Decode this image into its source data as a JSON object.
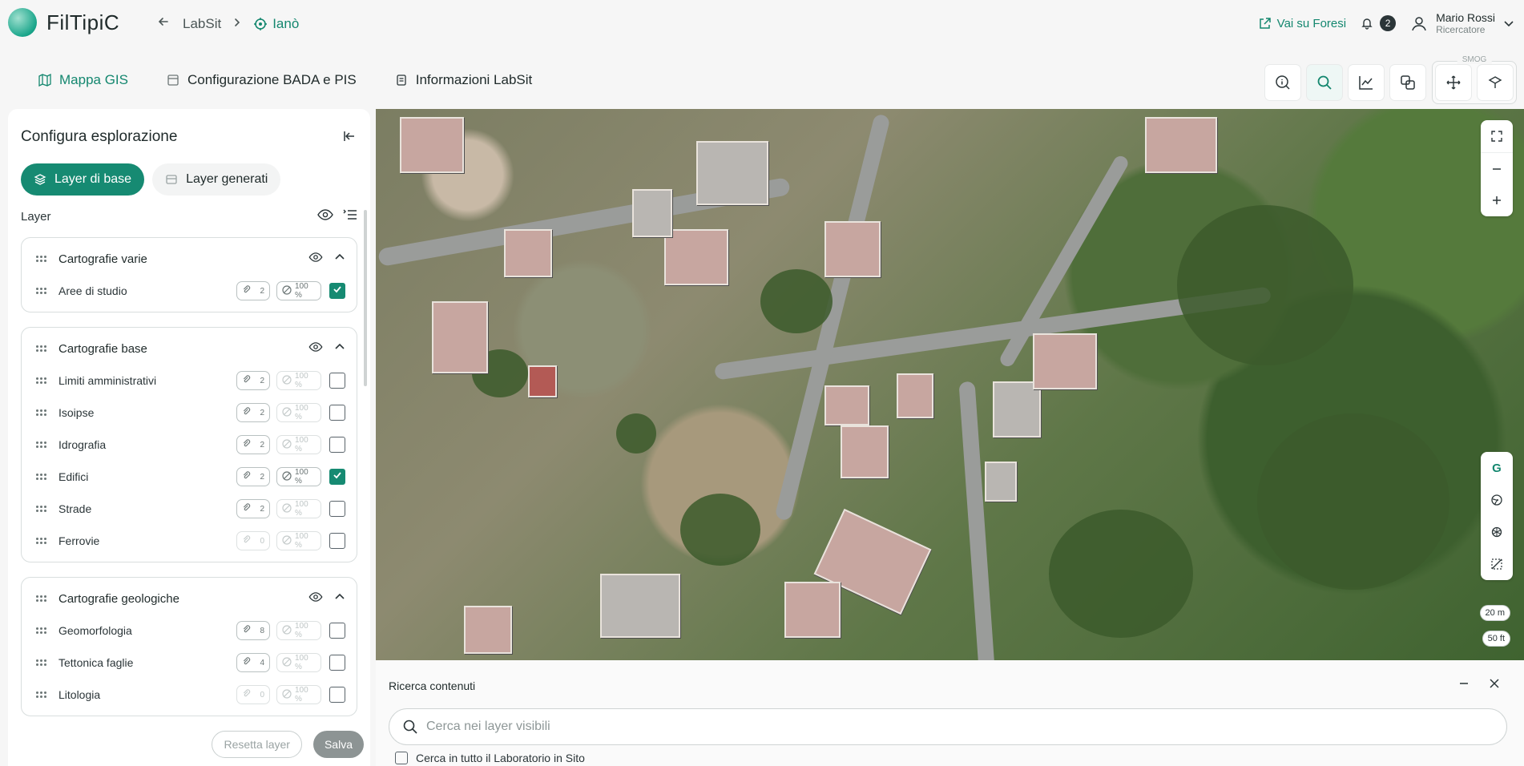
{
  "app": {
    "name": "FilTipiC"
  },
  "breadcrumb": {
    "back_label": "←",
    "parent": "LabSit",
    "current": "Ianò"
  },
  "header": {
    "external_link": "Vai su Foresi",
    "notifications_count": "2",
    "user": {
      "name": "Mario Rossi",
      "role": "Ricercatore"
    }
  },
  "nav_tabs": [
    {
      "label": "Mappa GIS",
      "active": true
    },
    {
      "label": "Configurazione BADA e PIS",
      "active": false
    },
    {
      "label": "Informazioni LabSit",
      "active": false
    }
  ],
  "toolbar": {
    "smog_label": "SMOG"
  },
  "panel": {
    "title": "Configura esplorazione",
    "tabs": [
      {
        "label": "Layer di base",
        "active": true
      },
      {
        "label": "Layer generati",
        "active": false
      }
    ],
    "layer_header": "Layer",
    "groups": [
      {
        "title": "Cartografie varie",
        "layers": [
          {
            "name": "Aree di studio",
            "count": "2",
            "opacity": "100 %",
            "checked": true,
            "enabled": true
          }
        ]
      },
      {
        "title": "Cartografie base",
        "layers": [
          {
            "name": "Limiti amministrativi",
            "count": "2",
            "opacity": "100 %",
            "checked": false,
            "enabled": true
          },
          {
            "name": "Isoipse",
            "count": "2",
            "opacity": "100 %",
            "checked": false,
            "enabled": true
          },
          {
            "name": "Idrografia",
            "count": "2",
            "opacity": "100 %",
            "checked": false,
            "enabled": true
          },
          {
            "name": "Edifici",
            "count": "2",
            "opacity": "100 %",
            "checked": true,
            "enabled": true
          },
          {
            "name": "Strade",
            "count": "2",
            "opacity": "100 %",
            "checked": false,
            "enabled": true
          },
          {
            "name": "Ferrovie",
            "count": "0",
            "opacity": "100 %",
            "checked": false,
            "enabled": false
          }
        ]
      },
      {
        "title": "Cartografie geologiche",
        "layers": [
          {
            "name": "Geomorfologia",
            "count": "8",
            "opacity": "100 %",
            "checked": false,
            "enabled": true
          },
          {
            "name": "Tettonica faglie",
            "count": "4",
            "opacity": "100 %",
            "checked": false,
            "enabled": true
          },
          {
            "name": "Litologia",
            "count": "0",
            "opacity": "100 %",
            "checked": false,
            "enabled": false
          }
        ]
      }
    ],
    "footer": {
      "reset_label": "Resetta layer",
      "save_label": "Salva"
    }
  },
  "map": {
    "scale_metric": "20 m",
    "scale_imperial": "50 ft"
  },
  "search": {
    "title": "Ricerca contenuti",
    "placeholder": "Cerca nei layer visibili",
    "checkbox_label": "Cerca in tutto il Laboratorio in Sito"
  },
  "colors": {
    "accent": "#168a72",
    "accent_text": "#14876f",
    "dark": "#1f2a2a"
  }
}
